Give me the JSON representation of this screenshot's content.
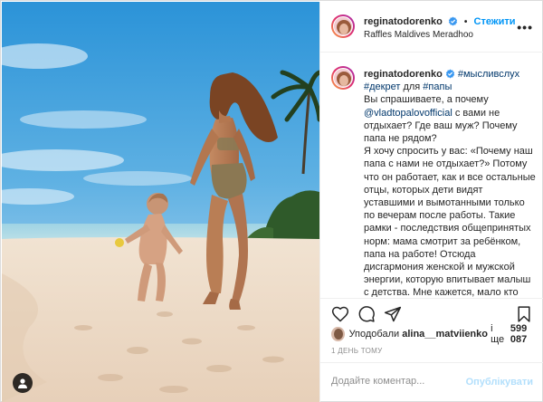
{
  "post": {
    "username": "reginatodorenko",
    "follow_label": "Стежити",
    "location": "Raffles Maldives Meradhoo",
    "more_icon": "more-horizontal-icon"
  },
  "caption": {
    "username": "reginatodorenko",
    "hashtag1": "#мысливслух",
    "hashtag2": "#декрет",
    "for_word": "для",
    "hashtag3": "#папы",
    "text1": "Вы спрашиваете, а почему",
    "mention": "@vladtopalovofficial",
    "text2": "с вами не отдыхает? Где ваш муж? Почему папа не рядом?",
    "text3": "Я хочу спросить у вас: «Почему наш папа с нами не отдыхает?» Потому что он работает, как и все остальные отцы, которых дети видят уставшими и вымотанными только по вечерам после работы. Такие рамки - последствия общепринятых норм: мама смотрит за ребёнком, папа на работе! Отсюда дисгармония женской и мужской энергии, которую впитывает малыш с детства. Мне кажется, мало кто может похвастаться участием обоих родителей в жизни ребёнка! А"
  },
  "actions": {
    "like": "heart-icon",
    "comment": "comment-icon",
    "share": "share-icon",
    "save": "bookmark-icon"
  },
  "likes": {
    "prefix": "Уподобали",
    "user": "alina__matviienko",
    "middle": "і ще",
    "count": "599 087"
  },
  "timestamp": "1 ДЕНЬ ТОМУ",
  "comment": {
    "placeholder": "Додайте коментар...",
    "publish_label": "Опублікувати"
  },
  "colors": {
    "link_blue": "#0095f6",
    "tag_blue": "#00376b",
    "publish_disabled": "#b2dffc",
    "muted": "#8e8e8e"
  }
}
